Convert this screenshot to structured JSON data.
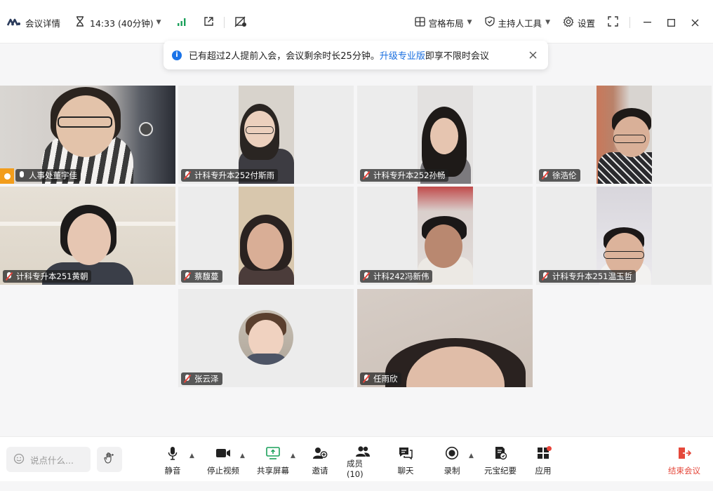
{
  "titlebar": {
    "meeting_details": "会议详情",
    "duration": "14:33 (40分钟)",
    "layout": "宫格布局",
    "host_tools": "主持人工具",
    "settings": "设置"
  },
  "notice": {
    "text_before": "已有超过2人提前入会，会议剩余时长25分钟。",
    "link": "升级专业版",
    "text_after": "即享不限时会议"
  },
  "participants": [
    {
      "name": "人事处董宇佳",
      "muted": false,
      "host": true,
      "speaking": true
    },
    {
      "name": "计科专升本252付斯雨",
      "muted": true
    },
    {
      "name": "计科专升本252孙畅",
      "muted": true
    },
    {
      "name": "徐浩伦",
      "muted": true
    },
    {
      "name": "计科专升本251黄朝",
      "muted": true
    },
    {
      "name": "蔡馥蔓",
      "muted": true
    },
    {
      "name": "计科242冯新伟",
      "muted": true
    },
    {
      "name": "计科专升本251温玉哲",
      "muted": true
    },
    {
      "name": "张云泽",
      "muted": true,
      "avatar_only": true
    },
    {
      "name": "任雨欣",
      "muted": true
    }
  ],
  "toolbar": {
    "chat_placeholder": "说点什么...",
    "mute": "静音",
    "stop_video": "停止视频",
    "share_screen": "共享屏幕",
    "invite": "邀请",
    "members": "成员(10)",
    "chat": "聊天",
    "record": "录制",
    "ai_minutes": "元宝纪要",
    "apps": "应用",
    "end_meeting": "结束会议"
  },
  "colors": {
    "accent_blue": "#1a6fe0",
    "speaking_green": "#2fb87a",
    "end_red": "#e5483b",
    "host_orange": "#f29d1c",
    "share_green": "#1aa05a"
  }
}
